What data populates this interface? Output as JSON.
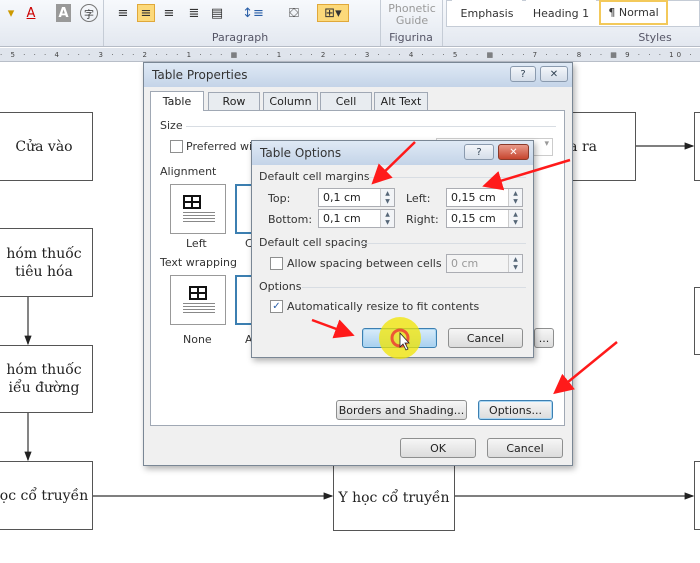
{
  "ribbon": {
    "groups": {
      "paragraph": "Paragraph",
      "figurina": "Figurina",
      "styles": "Styles"
    },
    "phonetic_guide": [
      "Phonetic",
      "Guide"
    ],
    "styles": [
      "Emphasis",
      "Heading 1",
      "¶ Normal"
    ],
    "icons": [
      "font-color-icon",
      "character-shading-icon",
      "enclosed-character-icon",
      "align-left-icon",
      "center-icon",
      "align-right-icon",
      "justify-icon",
      "distributed-icon",
      "line-spacing-icon",
      "shading-icon",
      "borders-icon"
    ]
  },
  "ruler": {
    "text": "· 5 · · · 4 · · · 3 · · · 2 · · · 1 · · · ▦ · · · 1 · · · 2 · · · 3 · · · 4 · · · 5 · · ▦ · · · 7 · · · 8 · · ▦ 9 · · · 10 · · · 11 · · · 12 · · · 13"
  },
  "document": {
    "boxes": {
      "entrance": "Cửa vào",
      "digestive": [
        "hóm thuốc",
        "tiêu hóa"
      ],
      "diabetes": [
        "hóm thuốc",
        "iểu đường"
      ],
      "traditional_left": "ọc cổ truyền",
      "traditional_center": "Y học cổ truyền",
      "exit": "a ra"
    }
  },
  "table_properties": {
    "title": "Table Properties",
    "tabs": [
      "Table",
      "Row",
      "Column",
      "Cell",
      "Alt Text"
    ],
    "size_label": "Size",
    "preferred_width": "Preferred wid",
    "alignment_label": "Alignment",
    "alignment_options": [
      "Left",
      "C"
    ],
    "text_wrapping_label": "Text wrapping",
    "wrapping_options": [
      "None",
      "A"
    ],
    "borders_button": "Borders and Shading...",
    "options_button": "Options...",
    "hidden_button": "...",
    "ok": "OK",
    "cancel": "Cancel",
    "help_icon": "?",
    "close_icon": "✕"
  },
  "table_options": {
    "title": "Table Options",
    "margins_label": "Default cell margins",
    "top_label": "Top:",
    "top_value": "0,1 cm",
    "bottom_label": "Bottom:",
    "bottom_value": "0,1 cm",
    "left_label": "Left:",
    "left_value": "0,15 cm",
    "right_label": "Right:",
    "right_value": "0,15 cm",
    "spacing_label": "Default cell spacing",
    "allow_spacing": "Allow spacing between cells",
    "allow_spacing_checked": false,
    "spacing_value": "0 cm",
    "options_label": "Options",
    "auto_resize": "Automatically resize to fit contents",
    "auto_resize_checked": true,
    "cancel": "Cancel",
    "help_icon": "?",
    "close_icon": "✕"
  },
  "annotations": {
    "arrow_color": "#ff1a1a",
    "cursor_highlight": "#f2e600"
  }
}
